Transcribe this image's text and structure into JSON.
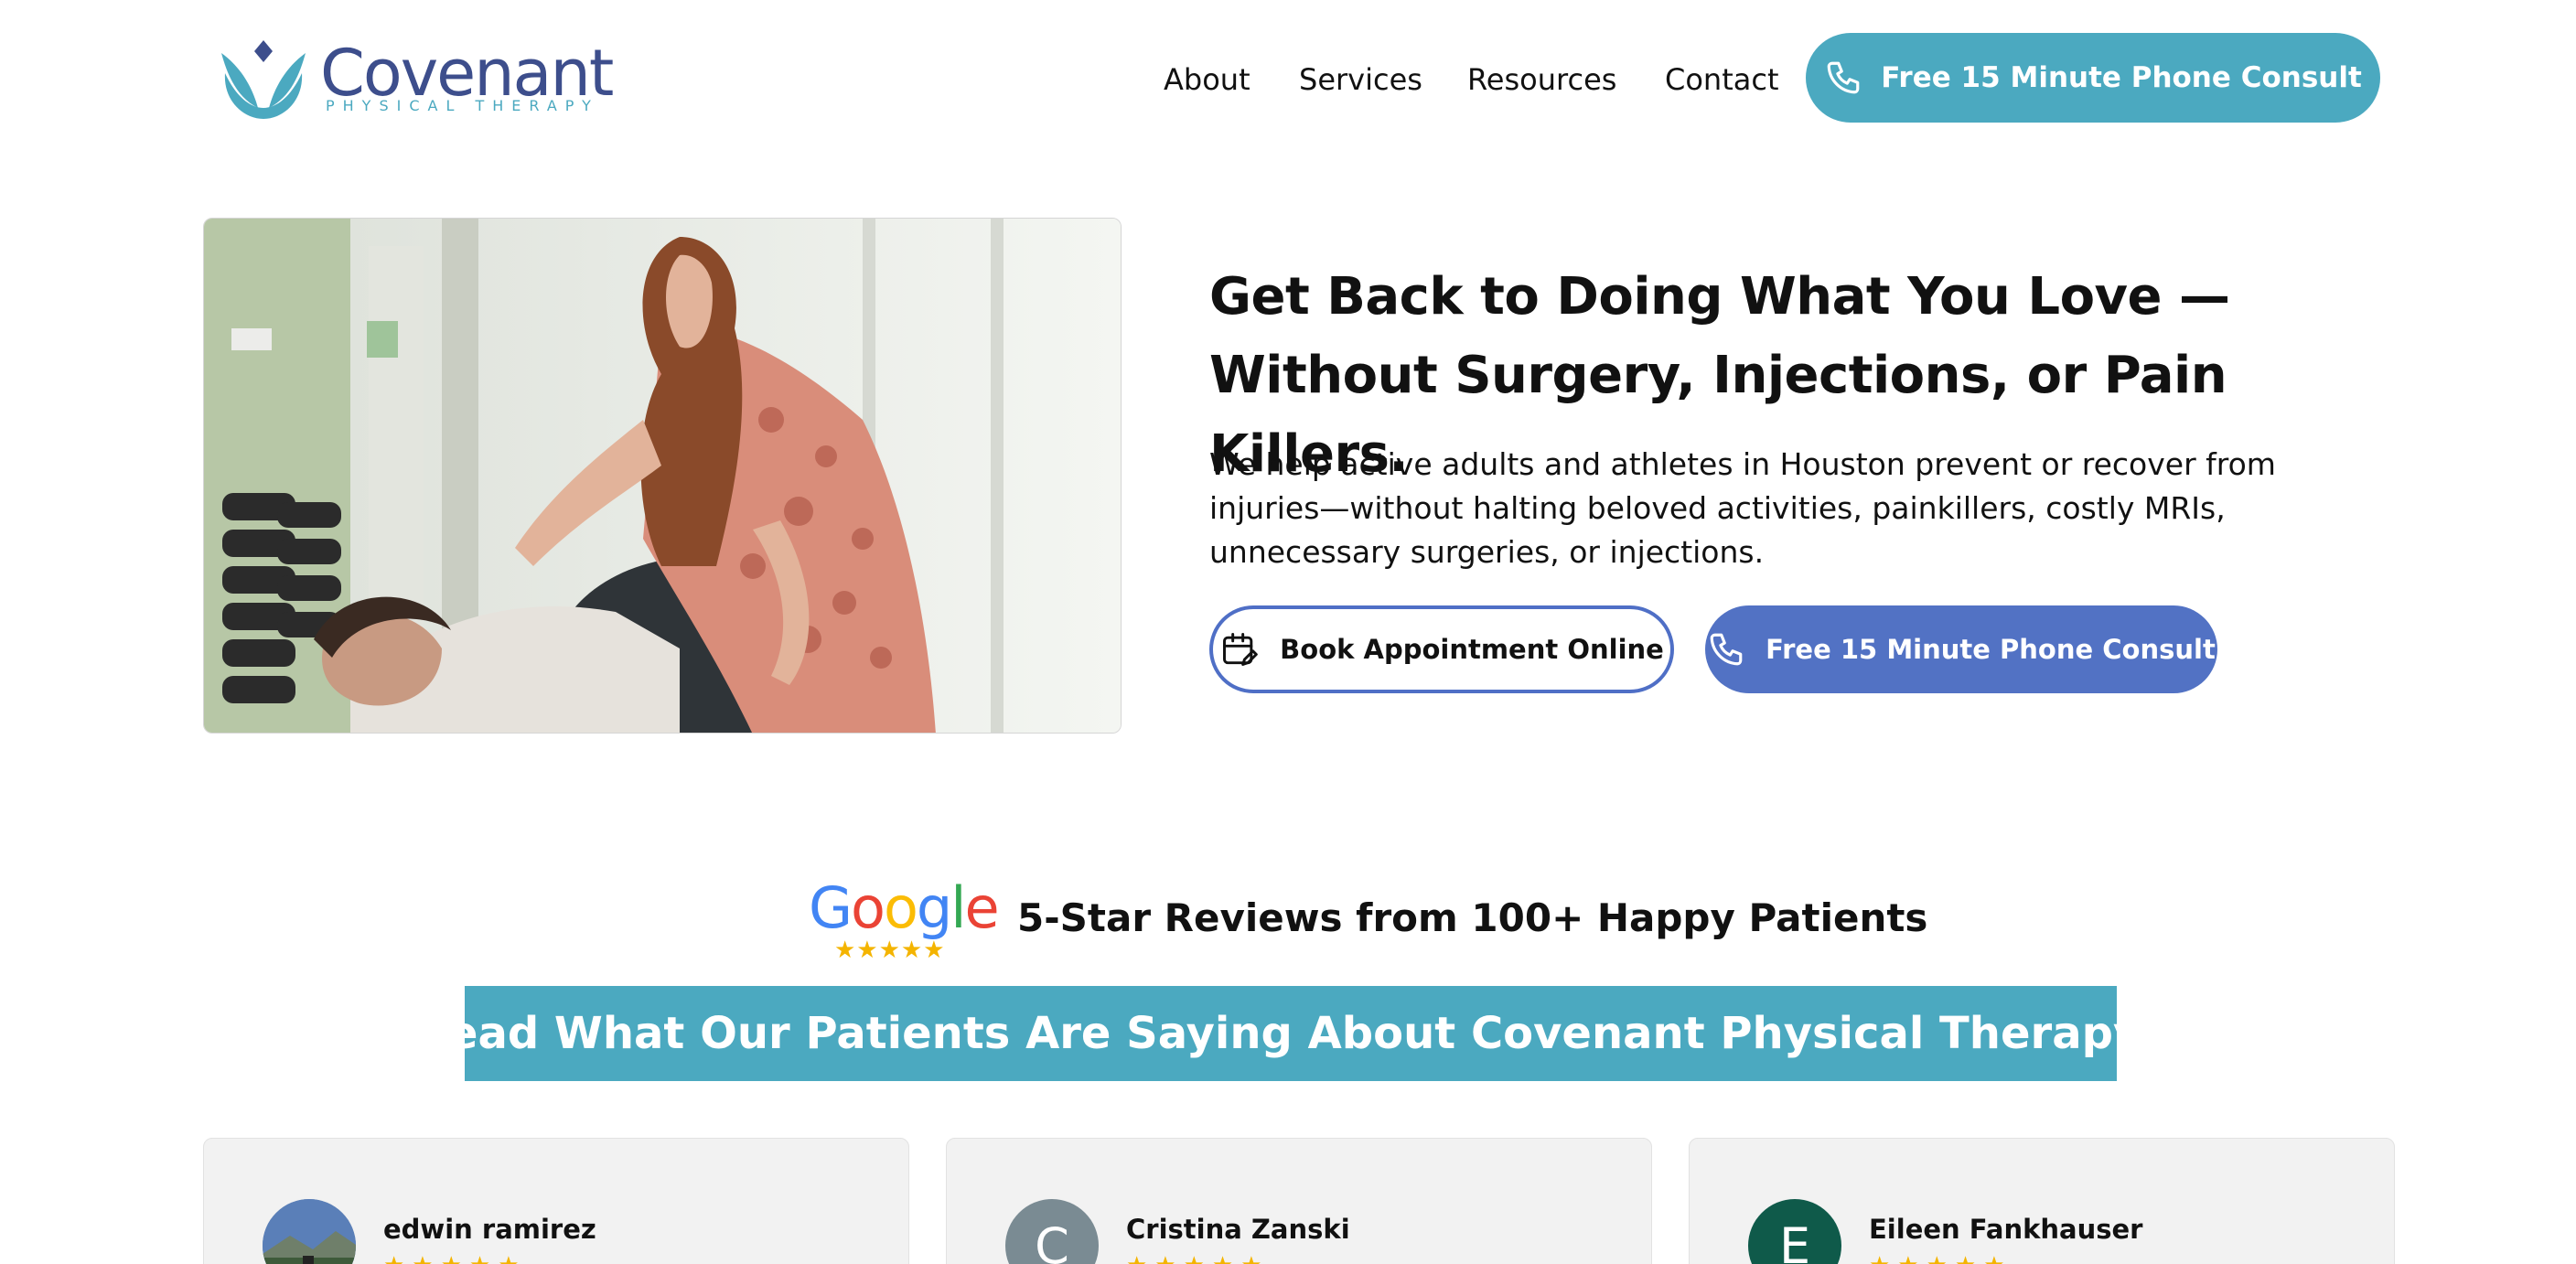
{
  "brand": {
    "name": "Covenant",
    "tagline": "PHYSICAL THERAPY",
    "color_primary": "#3d4e8c",
    "color_accent": "#4ba9c0"
  },
  "nav": {
    "items": [
      {
        "label": "About"
      },
      {
        "label": "Services"
      },
      {
        "label": "Resources"
      },
      {
        "label": "Contact"
      }
    ],
    "cta_label": "Free 15 Minute Phone Consult",
    "cta_icon": "phone-icon"
  },
  "hero": {
    "headline": "Get Back to Doing What You Love — Without Surgery, Injections, or Pain Killers.",
    "body": "We help active adults and athletes in Houston prevent or recover from injuries—without halting beloved activities, painkillers, costly MRIs, unnecessary surgeries, or injections.",
    "book_button_label": "Book Appointment Online",
    "book_button_icon": "calendar-edit-icon",
    "consult_button_label": "Free 15 Minute Phone Consult",
    "consult_button_icon": "phone-icon",
    "color_outline": "#4f6fc6",
    "color_fill": "#5272c4"
  },
  "reviews": {
    "google_logo_text": "Google",
    "google_rating_stars": 5,
    "heading": "5-Star Reviews from 100+ Happy Patients",
    "banner": "Read What Our Patients Are Saying About Covenant Physical Therapy?",
    "cards": [
      {
        "name": "edwin ramirez",
        "avatar_type": "photo",
        "avatar_letter": "",
        "avatar_color": "#6b88b0",
        "rating": 5
      },
      {
        "name": "Cristina Zanski",
        "avatar_type": "letter",
        "avatar_letter": "C",
        "avatar_color": "#7a8b93",
        "rating": 5
      },
      {
        "name": "Eileen Fankhauser",
        "avatar_type": "letter",
        "avatar_letter": "E",
        "avatar_color": "#0f5a4a",
        "rating": 5
      }
    ],
    "star_color": "#f4b400"
  }
}
